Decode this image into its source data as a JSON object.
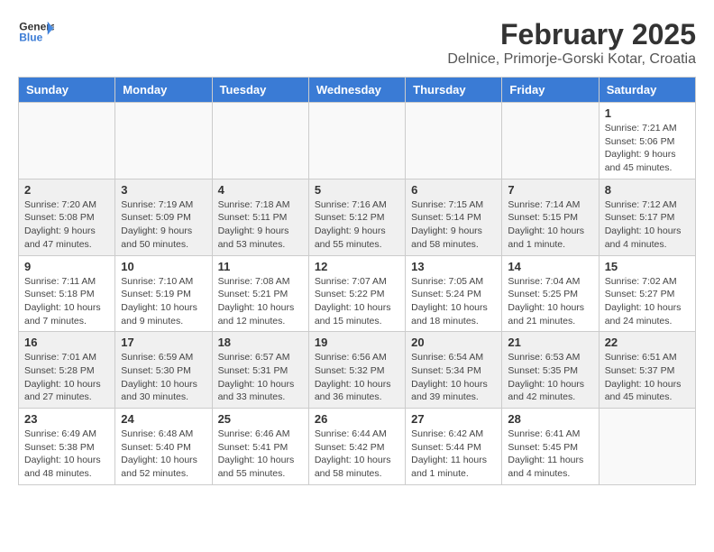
{
  "header": {
    "logo_general": "General",
    "logo_blue": "Blue",
    "month_year": "February 2025",
    "location": "Delnice, Primorje-Gorski Kotar, Croatia"
  },
  "days_of_week": [
    "Sunday",
    "Monday",
    "Tuesday",
    "Wednesday",
    "Thursday",
    "Friday",
    "Saturday"
  ],
  "weeks": [
    [
      {
        "day": "",
        "info": ""
      },
      {
        "day": "",
        "info": ""
      },
      {
        "day": "",
        "info": ""
      },
      {
        "day": "",
        "info": ""
      },
      {
        "day": "",
        "info": ""
      },
      {
        "day": "",
        "info": ""
      },
      {
        "day": "1",
        "info": "Sunrise: 7:21 AM\nSunset: 5:06 PM\nDaylight: 9 hours and 45 minutes."
      }
    ],
    [
      {
        "day": "2",
        "info": "Sunrise: 7:20 AM\nSunset: 5:08 PM\nDaylight: 9 hours and 47 minutes."
      },
      {
        "day": "3",
        "info": "Sunrise: 7:19 AM\nSunset: 5:09 PM\nDaylight: 9 hours and 50 minutes."
      },
      {
        "day": "4",
        "info": "Sunrise: 7:18 AM\nSunset: 5:11 PM\nDaylight: 9 hours and 53 minutes."
      },
      {
        "day": "5",
        "info": "Sunrise: 7:16 AM\nSunset: 5:12 PM\nDaylight: 9 hours and 55 minutes."
      },
      {
        "day": "6",
        "info": "Sunrise: 7:15 AM\nSunset: 5:14 PM\nDaylight: 9 hours and 58 minutes."
      },
      {
        "day": "7",
        "info": "Sunrise: 7:14 AM\nSunset: 5:15 PM\nDaylight: 10 hours and 1 minute."
      },
      {
        "day": "8",
        "info": "Sunrise: 7:12 AM\nSunset: 5:17 PM\nDaylight: 10 hours and 4 minutes."
      }
    ],
    [
      {
        "day": "9",
        "info": "Sunrise: 7:11 AM\nSunset: 5:18 PM\nDaylight: 10 hours and 7 minutes."
      },
      {
        "day": "10",
        "info": "Sunrise: 7:10 AM\nSunset: 5:19 PM\nDaylight: 10 hours and 9 minutes."
      },
      {
        "day": "11",
        "info": "Sunrise: 7:08 AM\nSunset: 5:21 PM\nDaylight: 10 hours and 12 minutes."
      },
      {
        "day": "12",
        "info": "Sunrise: 7:07 AM\nSunset: 5:22 PM\nDaylight: 10 hours and 15 minutes."
      },
      {
        "day": "13",
        "info": "Sunrise: 7:05 AM\nSunset: 5:24 PM\nDaylight: 10 hours and 18 minutes."
      },
      {
        "day": "14",
        "info": "Sunrise: 7:04 AM\nSunset: 5:25 PM\nDaylight: 10 hours and 21 minutes."
      },
      {
        "day": "15",
        "info": "Sunrise: 7:02 AM\nSunset: 5:27 PM\nDaylight: 10 hours and 24 minutes."
      }
    ],
    [
      {
        "day": "16",
        "info": "Sunrise: 7:01 AM\nSunset: 5:28 PM\nDaylight: 10 hours and 27 minutes."
      },
      {
        "day": "17",
        "info": "Sunrise: 6:59 AM\nSunset: 5:30 PM\nDaylight: 10 hours and 30 minutes."
      },
      {
        "day": "18",
        "info": "Sunrise: 6:57 AM\nSunset: 5:31 PM\nDaylight: 10 hours and 33 minutes."
      },
      {
        "day": "19",
        "info": "Sunrise: 6:56 AM\nSunset: 5:32 PM\nDaylight: 10 hours and 36 minutes."
      },
      {
        "day": "20",
        "info": "Sunrise: 6:54 AM\nSunset: 5:34 PM\nDaylight: 10 hours and 39 minutes."
      },
      {
        "day": "21",
        "info": "Sunrise: 6:53 AM\nSunset: 5:35 PM\nDaylight: 10 hours and 42 minutes."
      },
      {
        "day": "22",
        "info": "Sunrise: 6:51 AM\nSunset: 5:37 PM\nDaylight: 10 hours and 45 minutes."
      }
    ],
    [
      {
        "day": "23",
        "info": "Sunrise: 6:49 AM\nSunset: 5:38 PM\nDaylight: 10 hours and 48 minutes."
      },
      {
        "day": "24",
        "info": "Sunrise: 6:48 AM\nSunset: 5:40 PM\nDaylight: 10 hours and 52 minutes."
      },
      {
        "day": "25",
        "info": "Sunrise: 6:46 AM\nSunset: 5:41 PM\nDaylight: 10 hours and 55 minutes."
      },
      {
        "day": "26",
        "info": "Sunrise: 6:44 AM\nSunset: 5:42 PM\nDaylight: 10 hours and 58 minutes."
      },
      {
        "day": "27",
        "info": "Sunrise: 6:42 AM\nSunset: 5:44 PM\nDaylight: 11 hours and 1 minute."
      },
      {
        "day": "28",
        "info": "Sunrise: 6:41 AM\nSunset: 5:45 PM\nDaylight: 11 hours and 4 minutes."
      },
      {
        "day": "",
        "info": ""
      }
    ]
  ]
}
